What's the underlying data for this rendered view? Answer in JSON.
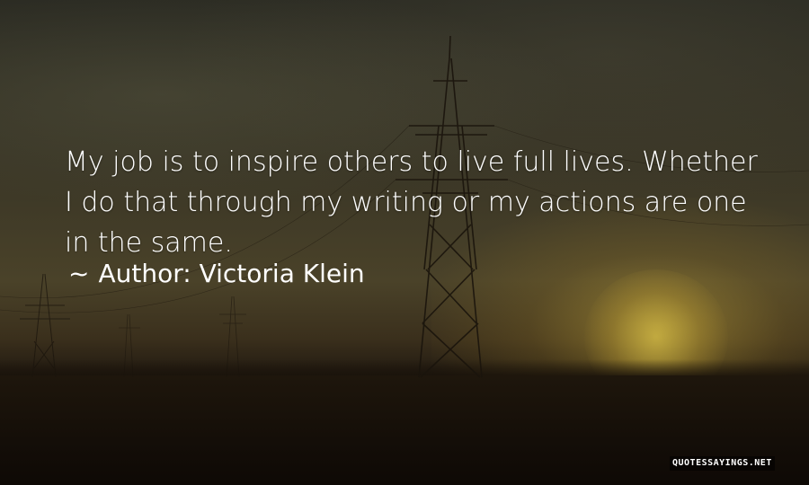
{
  "quote": {
    "line1": "My job is to inspire others to live full lives. Whether",
    "line2": "I do that through my writing or my actions are one",
    "line3": "in the same.",
    "author_prefix": "~",
    "author": "Author: Victoria Klein"
  },
  "watermark": "QUOTESSAYINGS.NET",
  "colors": {
    "text": "#ffffff",
    "sky": "#3a3626",
    "sun": "#d7be46",
    "ground": "#140e08"
  }
}
